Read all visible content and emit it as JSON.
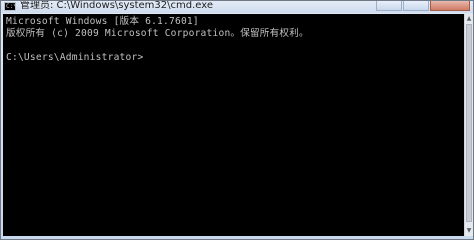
{
  "window": {
    "title": "管理员: C:\\Windows\\system32\\cmd.exe",
    "icon": "cmd-icon",
    "icon_glyph": "C:\\"
  },
  "console": {
    "lines": [
      "Microsoft Windows [版本 6.1.7601]",
      "版权所有 (c) 2009 Microsoft Corporation。保留所有权利。",
      "",
      "C:\\Users\\Administrator>"
    ]
  },
  "controls": {
    "minimize": "minimize-icon",
    "maximize": "maximize-icon",
    "close": "close-icon"
  },
  "scrollbar": {
    "up_glyph": "▲",
    "down_glyph": "▼"
  }
}
